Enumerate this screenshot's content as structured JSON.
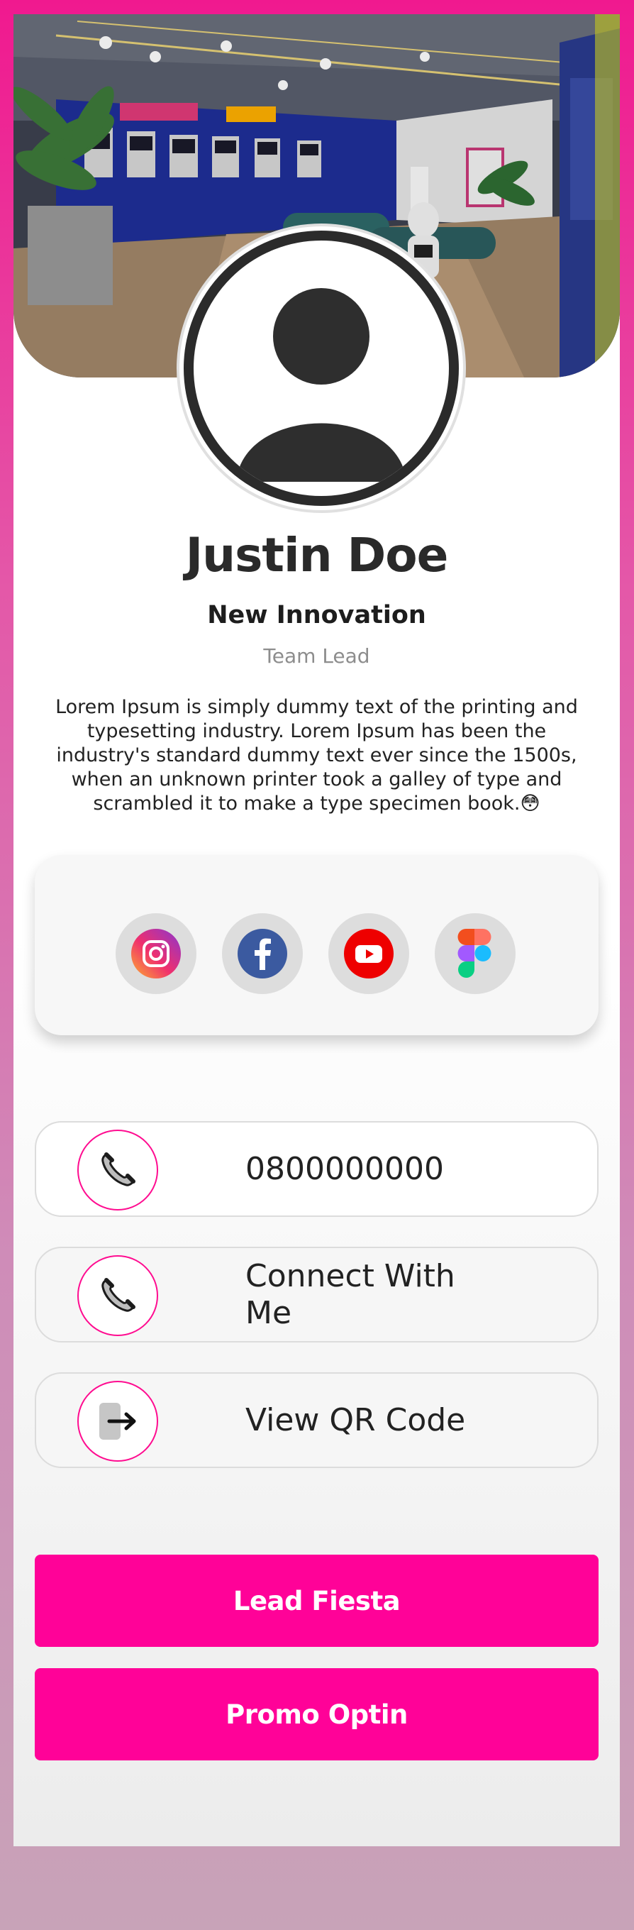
{
  "profile": {
    "name": "Justin Doe",
    "company": "New Innovation",
    "role": "Team Lead",
    "bio": "Lorem Ipsum is simply dummy text of the printing and typesetting industry. Lorem Ipsum has been the industry's standard dummy text ever since the 1500s, when an unknown printer took a galley of type and scrambled it to make a type specimen book.😳"
  },
  "social": [
    {
      "icon": "instagram-icon"
    },
    {
      "icon": "facebook-icon"
    },
    {
      "icon": "youtube-icon"
    },
    {
      "icon": "figma-icon"
    }
  ],
  "actions": {
    "phone": {
      "label": "0800000000",
      "icon": "phone-icon"
    },
    "connect": {
      "label": "Connect With Me",
      "icon": "phone-icon"
    },
    "qr": {
      "label": "View QR Code",
      "icon": "sign-in-icon"
    }
  },
  "buttons": {
    "lead": "Lead Fiesta",
    "promo": "Promo Optin"
  },
  "colors": {
    "accent": "#ff0298",
    "ring": "#ff0c90",
    "text": "#222222"
  }
}
